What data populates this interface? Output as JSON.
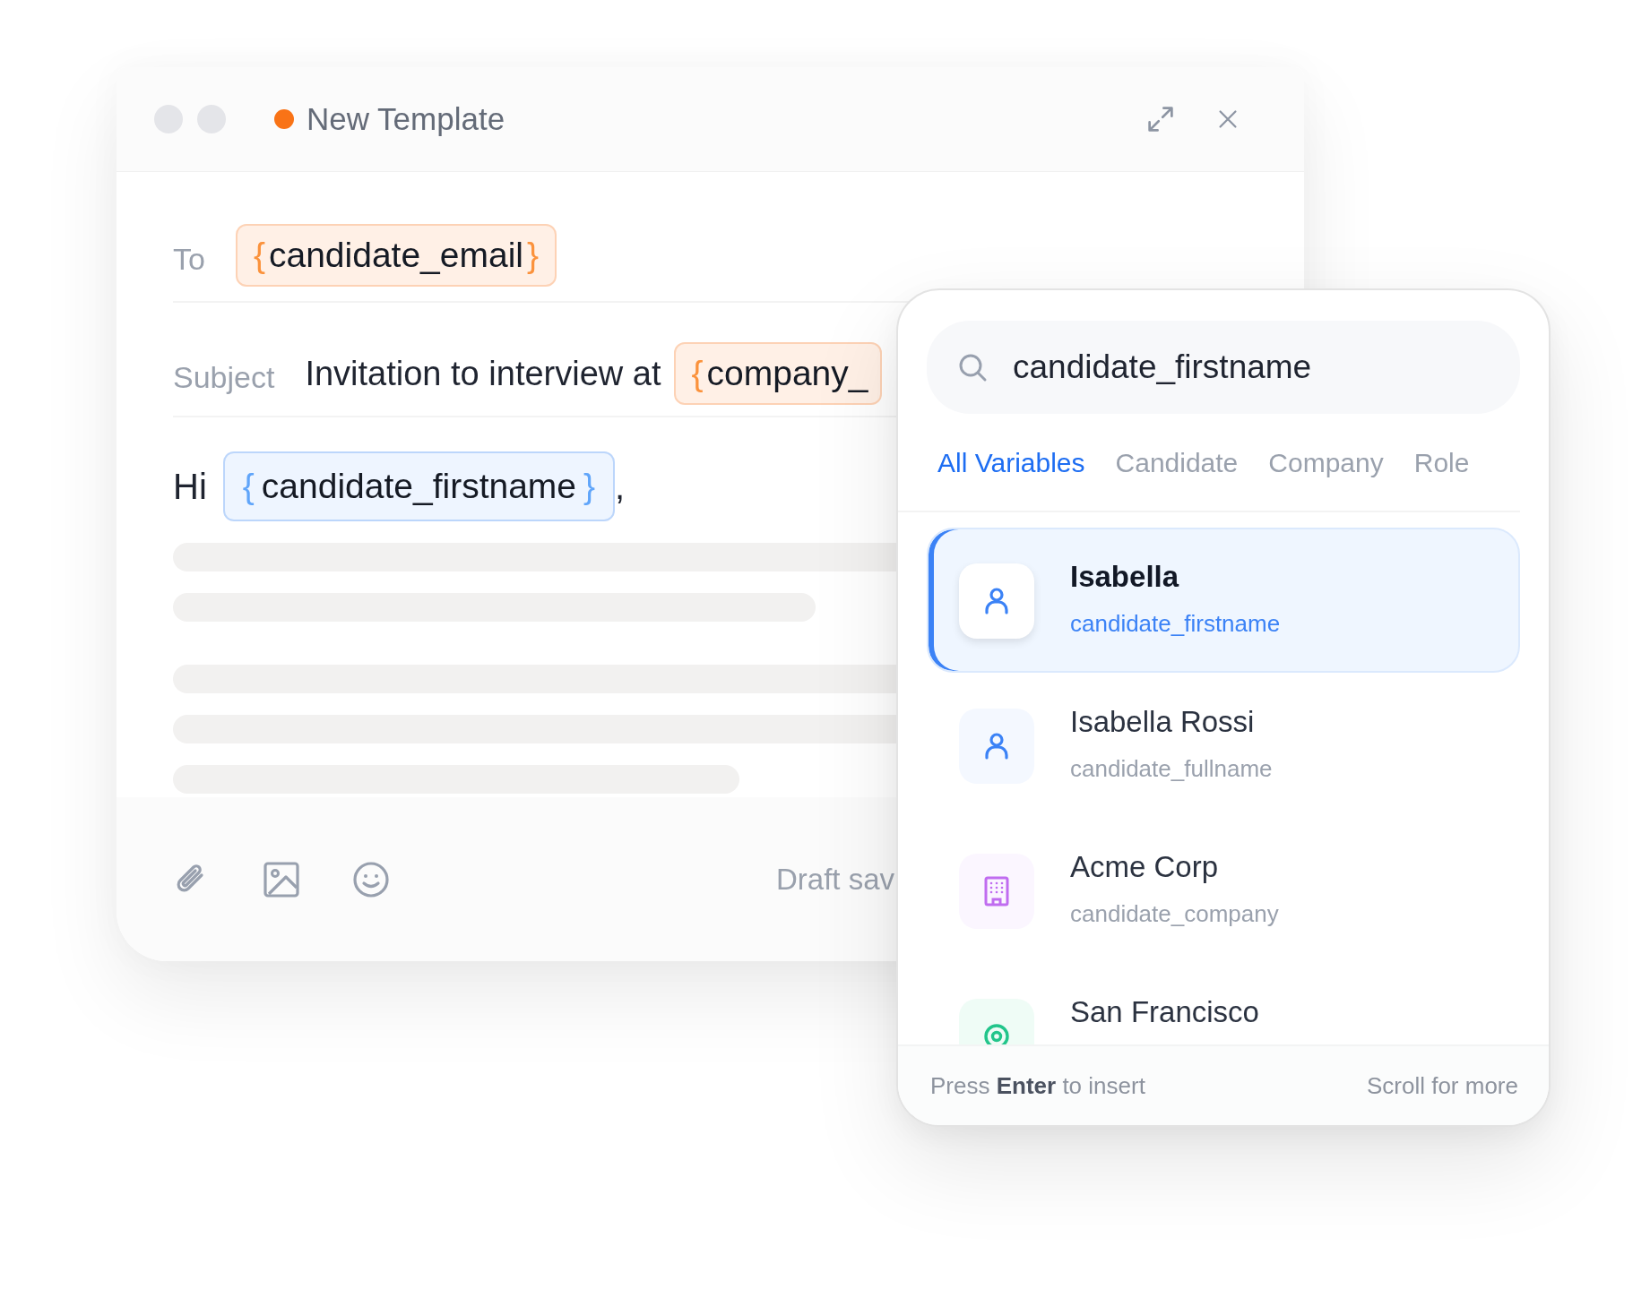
{
  "window": {
    "title": "New Template",
    "unsaved": true
  },
  "fields": [
    {
      "label": "To",
      "parts": [
        {
          "kind": "chip",
          "braces": [
            "{",
            "}"
          ],
          "text": "candidate_email",
          "selected": false
        }
      ]
    },
    {
      "label": "Subject",
      "parts": [
        {
          "kind": "text",
          "text": "Invitation to interview at"
        },
        {
          "kind": "chip",
          "braces": [
            "{"
          ],
          "text": "company_",
          "selected": false
        }
      ]
    }
  ],
  "body": {
    "parts": [
      {
        "kind": "text",
        "text": "Hi"
      },
      {
        "kind": "chip",
        "braces": [
          "{",
          "}"
        ],
        "text": "candidate_firstname",
        "selected": true
      },
      {
        "kind": "text",
        "text": ","
      }
    ]
  },
  "footer": {
    "status": "Draft sav"
  },
  "picker": {
    "search": {
      "value": "candidate_firstname"
    },
    "tabs": [
      {
        "label": "All Variables",
        "selected": true
      },
      {
        "label": "Candidate",
        "selected": false
      },
      {
        "label": "Company",
        "selected": false
      },
      {
        "label": "Role",
        "selected": false
      }
    ],
    "items": [
      {
        "title": "Isabella",
        "variable": "candidate_firstname",
        "kind": "person",
        "selected": true
      },
      {
        "title": "Isabella Rossi",
        "variable": "candidate_fullname",
        "kind": "person",
        "selected": false
      },
      {
        "title": "Acme Corp",
        "variable": "candidate_company",
        "kind": "building",
        "selected": false
      },
      {
        "title": "San Francisco",
        "kind": "location",
        "selected": false
      }
    ],
    "hint": "Press **Enter** to insert",
    "more": "Scroll for more"
  }
}
